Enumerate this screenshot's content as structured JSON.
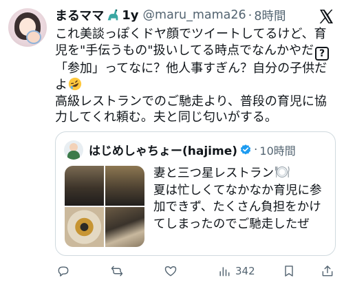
{
  "tweet": {
    "author_name": "まるママ",
    "author_name_suffix": "1y",
    "handle": "@maru_mama26",
    "separator": "·",
    "time": "8時間",
    "paragraph1": "これ美談っぽくドヤ顔でツイートしてるけど、育児を\"手伝うもの\"扱いしてる時点でなんかやだ",
    "paragraph1_icon": "?",
    "paragraph2": "「参加」ってなに？他人事すぎん？自分の子供だよ",
    "paragraph3": "高級レストランでのご馳走より、普段の育児に協力してくれ頼む。夫と同じ匂いがする。",
    "icons": [
      "dinosaur-emoji",
      "question-box-emoji",
      "rofl-emoji",
      "x-logo"
    ]
  },
  "quote": {
    "author_name": "はじめしゃちょー(hajime)",
    "separator": "·",
    "time": "10時間",
    "text_line1": "妻と三つ星レストラン",
    "text_rest": "夏は忙しくてなかなか育児に参加できず、たくさん負担をかけてしまったのでご馳走したぜ",
    "icons": [
      "verified-badge-icon",
      "plate-cutlery-emoji"
    ]
  },
  "actions": {
    "views": "342",
    "icons": [
      "reply-icon",
      "retweet-icon",
      "like-icon",
      "views-icon",
      "bookmark-icon",
      "share-icon"
    ]
  },
  "colors": {
    "text": "#0f1419",
    "secondary": "#536471",
    "border": "#cfd9de",
    "verified": "#1d9bf0"
  }
}
